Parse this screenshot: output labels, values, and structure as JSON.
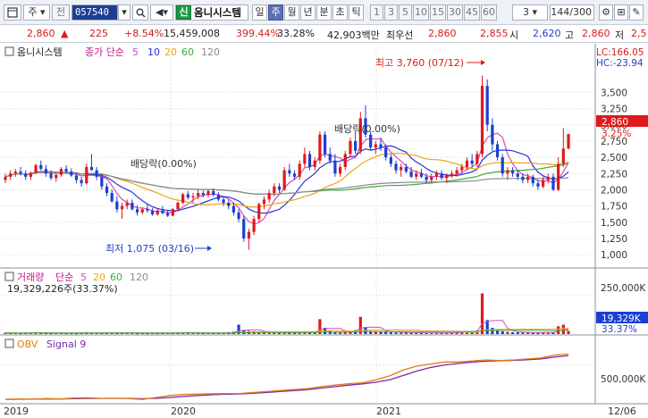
{
  "toolbar": {
    "menu_icon": "layout-icon",
    "type_select": "주",
    "prev_label": "전",
    "stock_code": "057540",
    "badge": "신",
    "stock_name": "옴니시스템",
    "periods": [
      "일",
      "주",
      "월",
      "년",
      "분",
      "초",
      "틱"
    ],
    "active_period": "주",
    "intervals": [
      "1",
      "3",
      "5",
      "10",
      "15",
      "30",
      "45",
      "60"
    ],
    "interval_select": "3",
    "count_display": "144/300",
    "right_icons": [
      "settings-icon",
      "indicator-icon",
      "tools-icon",
      "grid-icon"
    ]
  },
  "quote": {
    "price": "2,860",
    "change": "225",
    "change_pct": "+8.54%",
    "volume": "15,459,008",
    "volume_ratio": "399.44%",
    "turnover": "33.28%",
    "amount": "42,903백만",
    "best_ask_label": "최우선",
    "best_ask": "2,860",
    "best_bid": "2,855",
    "open_label": "시",
    "open": "2,620",
    "high_label": "고",
    "high": "2,860",
    "low_label": "저",
    "low": "2,5"
  },
  "colors": {
    "up": "#e0191c",
    "down": "#1c3ed3",
    "ma5": "#d14fb8",
    "ma10": "#2a33d8",
    "ma20": "#e8a717",
    "ma60": "#41a83c",
    "ma120": "#8b8b8b",
    "obv": "#e07b14",
    "signal": "#7a29a8"
  },
  "price_panel": {
    "title": "옴니시스템",
    "ma_label": "종가 단순",
    "ma_periods": [
      "5",
      "10",
      "20",
      "60",
      "120"
    ],
    "lc_label": "LC:166.05",
    "hc_label": "HC:-23.94",
    "current_price_tag": "2,860",
    "current_pct_tag": "3.25%",
    "high_annotation": "최고 3,760 (07/12)",
    "low_annotation": "최저 1,075 (03/16)",
    "dividend_labels": [
      "배당락(0.00%)",
      "배당락(0.00%)"
    ],
    "y_ticks": [
      "3,500",
      "3,250",
      "3,000",
      "2,750",
      "2,500",
      "2,250",
      "2,000",
      "1,750",
      "1,500",
      "1,250",
      "1,000"
    ]
  },
  "volume_panel": {
    "title": "거래량",
    "ma_label": "단순",
    "ma_periods": [
      "5",
      "20",
      "60",
      "120"
    ],
    "value_text": "19,329,226주(33.37%)",
    "y_tick": "250,000K",
    "current_tag": "19,329K",
    "current_pct_tag": "33.37%"
  },
  "obv_panel": {
    "title": "OBV",
    "signal_label": "Signal 9",
    "y_tick": "500,000K"
  },
  "x_axis": {
    "labels": [
      "2019",
      "2020",
      "2021",
      "12/06"
    ]
  },
  "chart_data": [
    {
      "type": "candlestick",
      "title": "옴니시스템",
      "ylim": [
        850,
        3850
      ],
      "y_ticks": [
        1000,
        1250,
        1500,
        1750,
        2000,
        2250,
        2500,
        2750,
        3000,
        3250,
        3500
      ],
      "x_labels": [
        "2019",
        "2020",
        "2021",
        "12/06"
      ],
      "high": {
        "value": 3760,
        "date": "07/12"
      },
      "low": {
        "value": 1075,
        "date": "03/16"
      },
      "last": 2860,
      "candles": [
        [
          2150,
          2250,
          2100,
          2200
        ],
        [
          2200,
          2300,
          2150,
          2250
        ],
        [
          2250,
          2320,
          2200,
          2280
        ],
        [
          2280,
          2350,
          2220,
          2250
        ],
        [
          2250,
          2300,
          2150,
          2200
        ],
        [
          2200,
          2280,
          2150,
          2260
        ],
        [
          2260,
          2400,
          2240,
          2380
        ],
        [
          2380,
          2450,
          2300,
          2320
        ],
        [
          2320,
          2380,
          2200,
          2250
        ],
        [
          2250,
          2300,
          2150,
          2180
        ],
        [
          2180,
          2250,
          2120,
          2230
        ],
        [
          2230,
          2350,
          2200,
          2320
        ],
        [
          2320,
          2380,
          2250,
          2280
        ],
        [
          2280,
          2330,
          2200,
          2220
        ],
        [
          2220,
          2250,
          2100,
          2150
        ],
        [
          2150,
          2200,
          2050,
          2100
        ],
        [
          2100,
          2400,
          2080,
          2350
        ],
        [
          2350,
          2550,
          2300,
          2300
        ],
        [
          2300,
          2350,
          2150,
          2200
        ],
        [
          2200,
          2250,
          2000,
          2050
        ],
        [
          2050,
          2100,
          1900,
          1950
        ],
        [
          1950,
          2000,
          1800,
          1820
        ],
        [
          1820,
          1900,
          1650,
          1700
        ],
        [
          1700,
          1800,
          1550,
          1750
        ],
        [
          1750,
          1850,
          1700,
          1800
        ],
        [
          1800,
          1850,
          1680,
          1700
        ],
        [
          1700,
          1760,
          1600,
          1650
        ],
        [
          1650,
          1720,
          1620,
          1700
        ],
        [
          1700,
          1780,
          1650,
          1680
        ],
        [
          1680,
          1720,
          1600,
          1620
        ],
        [
          1620,
          1700,
          1600,
          1680
        ],
        [
          1680,
          1750,
          1620,
          1640
        ],
        [
          1640,
          1680,
          1580,
          1600
        ],
        [
          1600,
          1720,
          1590,
          1700
        ],
        [
          1700,
          1820,
          1680,
          1800
        ],
        [
          1800,
          1950,
          1780,
          1930
        ],
        [
          1930,
          1980,
          1850,
          1880
        ],
        [
          1880,
          1950,
          1800,
          1900
        ],
        [
          1900,
          2000,
          1850,
          1950
        ],
        [
          1950,
          1990,
          1880,
          1920
        ],
        [
          1920,
          2000,
          1880,
          1980
        ],
        [
          1980,
          2020,
          1900,
          1920
        ],
        [
          1920,
          1960,
          1820,
          1850
        ],
        [
          1850,
          1900,
          1750,
          1800
        ],
        [
          1800,
          1850,
          1700,
          1750
        ],
        [
          1750,
          1800,
          1600,
          1650
        ],
        [
          1650,
          1700,
          1500,
          1550
        ],
        [
          1550,
          1600,
          1200,
          1250
        ],
        [
          1250,
          1400,
          1075,
          1350
        ],
        [
          1350,
          1600,
          1300,
          1550
        ],
        [
          1550,
          1800,
          1500,
          1780
        ],
        [
          1780,
          1900,
          1700,
          1850
        ],
        [
          1850,
          2000,
          1800,
          1950
        ],
        [
          1950,
          2100,
          1900,
          2050
        ],
        [
          2050,
          2100,
          1950,
          2000
        ],
        [
          2000,
          2350,
          1980,
          2300
        ],
        [
          2300,
          2400,
          2200,
          2250
        ],
        [
          2250,
          2300,
          2150,
          2200
        ],
        [
          2200,
          2450,
          2150,
          2400
        ],
        [
          2400,
          2650,
          2350,
          2550
        ],
        [
          2550,
          2600,
          2300,
          2350
        ],
        [
          2350,
          2500,
          2300,
          2450
        ],
        [
          2450,
          2900,
          2400,
          2850
        ],
        [
          2850,
          2900,
          2500,
          2550
        ],
        [
          2550,
          2650,
          2400,
          2450
        ],
        [
          2450,
          2550,
          2200,
          2250
        ],
        [
          2250,
          2400,
          2200,
          2350
        ],
        [
          2350,
          2600,
          2300,
          2550
        ],
        [
          2550,
          2800,
          2500,
          2750
        ],
        [
          2750,
          2900,
          2550,
          2600
        ],
        [
          2600,
          3200,
          2550,
          3100
        ],
        [
          3100,
          3300,
          2800,
          2850
        ],
        [
          2850,
          2900,
          2600,
          2650
        ],
        [
          2650,
          2750,
          2550,
          2700
        ],
        [
          2700,
          2800,
          2600,
          2650
        ],
        [
          2650,
          2700,
          2450,
          2500
        ],
        [
          2500,
          2550,
          2350,
          2400
        ],
        [
          2400,
          2450,
          2250,
          2300
        ],
        [
          2300,
          2400,
          2200,
          2350
        ],
        [
          2350,
          2400,
          2250,
          2280
        ],
        [
          2280,
          2350,
          2180,
          2200
        ],
        [
          2200,
          2300,
          2150,
          2250
        ],
        [
          2250,
          2320,
          2180,
          2200
        ],
        [
          2200,
          2250,
          2100,
          2150
        ],
        [
          2150,
          2250,
          2100,
          2200
        ],
        [
          2200,
          2300,
          2150,
          2250
        ],
        [
          2250,
          2300,
          2150,
          2180
        ],
        [
          2180,
          2250,
          2100,
          2220
        ],
        [
          2220,
          2300,
          2180,
          2250
        ],
        [
          2250,
          2350,
          2200,
          2300
        ],
        [
          2300,
          2400,
          2250,
          2350
        ],
        [
          2350,
          2500,
          2300,
          2450
        ],
        [
          2450,
          2550,
          2350,
          2400
        ],
        [
          2400,
          2600,
          2350,
          2550
        ],
        [
          2550,
          3760,
          2500,
          3600
        ],
        [
          3600,
          3700,
          2900,
          3000
        ],
        [
          3000,
          3100,
          2600,
          2700
        ],
        [
          2700,
          2750,
          2450,
          2500
        ],
        [
          2500,
          2550,
          2200,
          2250
        ],
        [
          2250,
          2350,
          2150,
          2300
        ],
        [
          2300,
          2350,
          2200,
          2250
        ],
        [
          2250,
          2300,
          2150,
          2200
        ],
        [
          2200,
          2250,
          2100,
          2150
        ],
        [
          2150,
          2250,
          2100,
          2200
        ],
        [
          2200,
          2230,
          2050,
          2100
        ],
        [
          2100,
          2150,
          2000,
          2050
        ],
        [
          2050,
          2200,
          2020,
          2150
        ],
        [
          2150,
          2250,
          2100,
          2200
        ],
        [
          2200,
          2250,
          1980,
          2000
        ],
        [
          2000,
          2500,
          1980,
          2400
        ],
        [
          2400,
          2950,
          2350,
          2635
        ],
        [
          2635,
          2860,
          2620,
          2860
        ]
      ]
    },
    {
      "type": "bar",
      "title": "거래량",
      "ylim": [
        0,
        320000
      ],
      "y_ticks": [
        250000
      ],
      "unit": "K",
      "last": 19329,
      "values": [
        8000,
        7000,
        6000,
        5000,
        9000,
        8000,
        12000,
        7000,
        6000,
        5000,
        6000,
        7000,
        5000,
        6000,
        5000,
        6000,
        12000,
        9000,
        6000,
        7000,
        8000,
        9000,
        11000,
        8000,
        7000,
        6000,
        5000,
        6000,
        5000,
        6000,
        5000,
        6000,
        7000,
        9000,
        12000,
        10000,
        8000,
        7000,
        9000,
        8000,
        6000,
        7000,
        8000,
        9000,
        12000,
        15000,
        60000,
        25000,
        20000,
        18000,
        15000,
        12000,
        10000,
        9000,
        8000,
        12000,
        10000,
        9000,
        11000,
        14000,
        12000,
        10000,
        95000,
        40000,
        20000,
        14000,
        12000,
        15000,
        20000,
        25000,
        110000,
        45000,
        20000,
        18000,
        15000,
        14000,
        12000,
        10000,
        10000,
        9000,
        8000,
        9000,
        8000,
        7000,
        8000,
        9000,
        8000,
        9000,
        10000,
        12000,
        14000,
        18000,
        16000,
        22000,
        260000,
        90000,
        40000,
        25000,
        18000,
        14000,
        12000,
        11000,
        10000,
        9000,
        9000,
        10000,
        11000,
        10000,
        12000,
        50000,
        60000,
        19329
      ]
    },
    {
      "type": "line",
      "title": "OBV",
      "ylim": [
        -250000,
        800000
      ],
      "y_ticks": [
        500000
      ],
      "unit": "K",
      "series": [
        {
          "name": "OBV",
          "values": [
            -200000,
            -190000,
            -195000,
            -180000,
            -190000,
            -170000,
            -165000,
            -180000,
            -175000,
            -185000,
            -200000,
            -160000,
            -120000,
            -100000,
            -90000,
            -85000,
            -80000,
            -80000,
            -60000,
            -40000,
            -20000,
            0,
            20000,
            60000,
            90000,
            120000,
            140000,
            200000,
            280000,
            400000,
            480000,
            520000,
            560000,
            560000,
            580000,
            600000,
            590000,
            600000,
            620000,
            640000,
            700000,
            720000
          ]
        },
        {
          "name": "Signal 9",
          "values": [
            -200000,
            -195000,
            -193000,
            -190000,
            -190000,
            -185000,
            -180000,
            -180000,
            -178000,
            -180000,
            -185000,
            -178000,
            -160000,
            -140000,
            -120000,
            -105000,
            -95000,
            -88000,
            -75000,
            -60000,
            -40000,
            -20000,
            0,
            30000,
            60000,
            90000,
            115000,
            150000,
            200000,
            290000,
            380000,
            450000,
            500000,
            530000,
            555000,
            575000,
            585000,
            592000,
            605000,
            620000,
            660000,
            690000
          ]
        }
      ]
    }
  ]
}
